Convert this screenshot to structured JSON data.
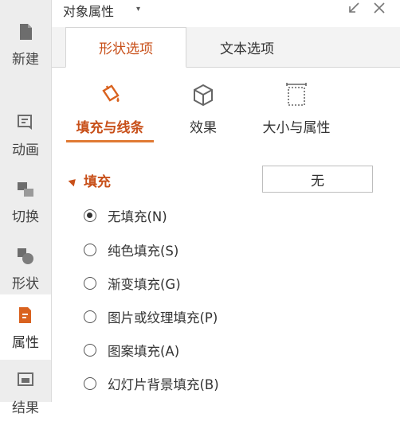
{
  "sidebar": {
    "items": [
      {
        "label": "新建",
        "icon": "document-icon"
      },
      {
        "label": "动画",
        "icon": "animation-icon"
      },
      {
        "label": "切换",
        "icon": "transition-icon"
      },
      {
        "label": "形状",
        "icon": "shapes-icon"
      },
      {
        "label": "属性",
        "icon": "properties-icon",
        "active": true
      },
      {
        "label": "结果",
        "icon": "image-icon"
      }
    ]
  },
  "panel": {
    "title": "对象属性",
    "title_caret": "▾"
  },
  "tabs": [
    {
      "label": "形状选项",
      "active": true
    },
    {
      "label": "文本选项",
      "active": false
    }
  ],
  "subtabs": [
    {
      "label": "填充与线条",
      "icon": "paint-bucket-icon",
      "active": true
    },
    {
      "label": "效果",
      "icon": "cube-icon",
      "active": false
    },
    {
      "label": "大小与属性",
      "icon": "size-frame-icon",
      "active": false
    }
  ],
  "fill_section": {
    "title": "填充",
    "dropdown_value": "无",
    "options": [
      {
        "label": "无填充(N)",
        "checked": true
      },
      {
        "label": "纯色填充(S)",
        "checked": false
      },
      {
        "label": "渐变填充(G)",
        "checked": false
      },
      {
        "label": "图片或纹理填充(P)",
        "checked": false
      },
      {
        "label": "图案填充(A)",
        "checked": false
      },
      {
        "label": "幻灯片背景填充(B)",
        "checked": false
      }
    ]
  },
  "colors": {
    "accent": "#c8501a",
    "underline": "#e07a34",
    "sidebar_bg": "#ededed",
    "tabbar_bg": "#f3f3f3"
  }
}
